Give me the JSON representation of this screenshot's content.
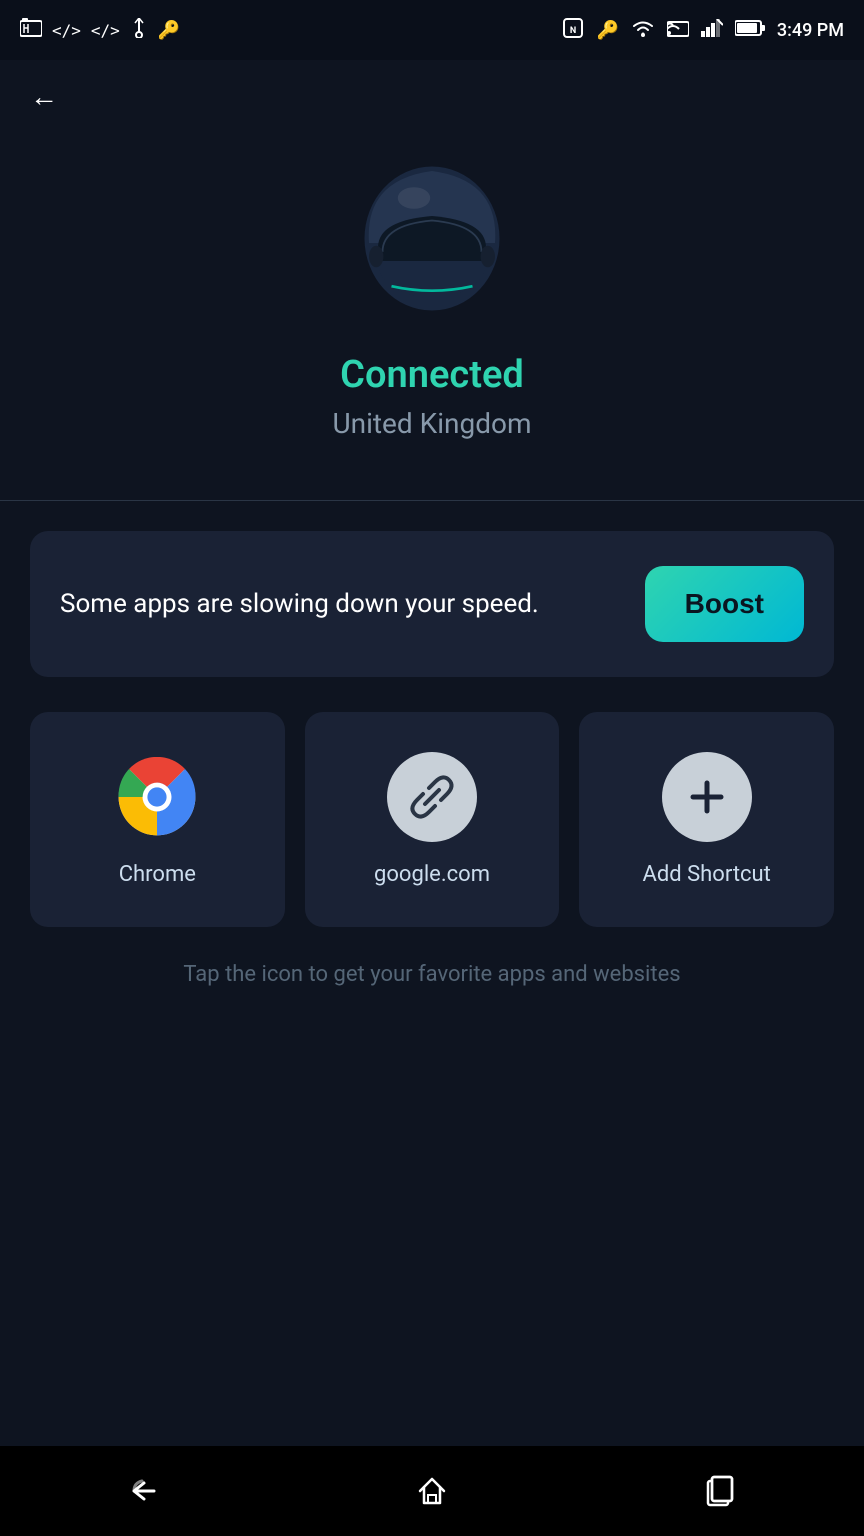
{
  "statusBar": {
    "time": "3:49 PM",
    "icons": [
      "screenshot",
      "code1",
      "code2",
      "usb",
      "key",
      "nfc",
      "key2",
      "wifi",
      "cast",
      "signal",
      "battery"
    ]
  },
  "back": {
    "label": "←"
  },
  "hero": {
    "connectedLabel": "Connected",
    "locationLabel": "United Kingdom"
  },
  "boostCard": {
    "message": "Some apps are slowing down your speed.",
    "buttonLabel": "Boost"
  },
  "shortcuts": [
    {
      "id": "chrome",
      "label": "Chrome",
      "type": "chrome"
    },
    {
      "id": "google",
      "label": "google.com",
      "type": "link"
    },
    {
      "id": "add",
      "label": "Add Shortcut",
      "type": "add"
    }
  ],
  "hintText": "Tap the icon to get your favorite apps and websites",
  "navBar": {
    "back": "↩",
    "home": "⌂",
    "recents": "❏"
  }
}
